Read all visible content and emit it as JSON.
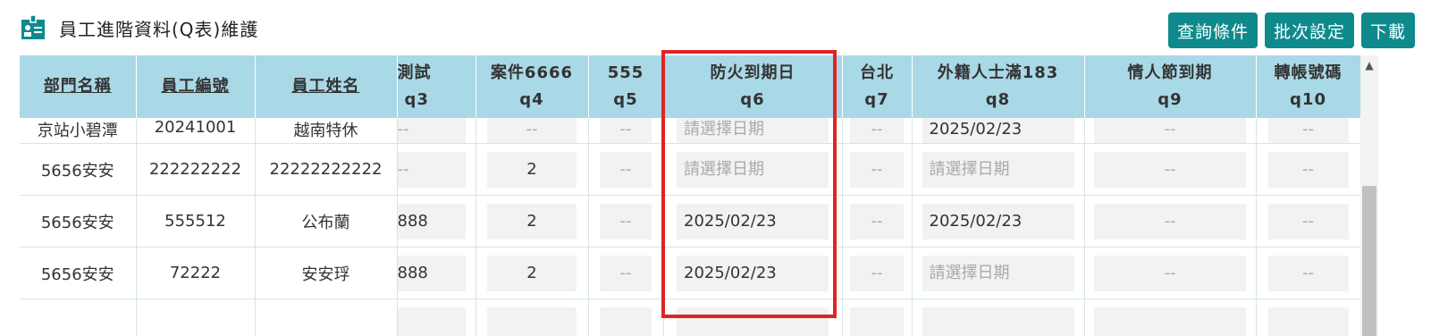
{
  "page": {
    "title": "員工進階資料(Q表)維護"
  },
  "toolbar": {
    "query_label": "查詢條件",
    "batch_label": "批次設定",
    "download_label": "下載"
  },
  "colors": {
    "accent": "#0f8a8c",
    "header_bg": "#a9d8e6",
    "highlight": "#e02424"
  },
  "icons": {
    "title": "id-card-icon",
    "scroll_up": "caret-up-icon"
  },
  "table": {
    "headers": [
      {
        "line1": "部門名稱",
        "line2": ""
      },
      {
        "line1": "員工編號",
        "line2": ""
      },
      {
        "line1": "員工姓名",
        "line2": ""
      },
      {
        "line1": "測試",
        "line2": "q3"
      },
      {
        "line1": "案件6666",
        "line2": "q4"
      },
      {
        "line1": "555",
        "line2": "q5"
      },
      {
        "line1": "防火到期日",
        "line2": "q6"
      },
      {
        "line1": "台北",
        "line2": "q7"
      },
      {
        "line1": "外籍人士滿183",
        "line2": "q8"
      },
      {
        "line1": "情人節到期",
        "line2": "q9"
      },
      {
        "line1": "轉帳號碼",
        "line2": "q10"
      }
    ],
    "rows": [
      {
        "dept": "京站小碧潭",
        "emp_no": "20241001",
        "name": "越南特休",
        "q3": "--",
        "q4": "--",
        "q5": "--",
        "q6": "請選擇日期",
        "q7": "--",
        "q8": "2025/02/23",
        "q9": "--",
        "q10": "--"
      },
      {
        "dept": "5656安安",
        "emp_no": "222222222",
        "name": "22222222222",
        "q3": "--",
        "q4": "2",
        "q5": "--",
        "q6": "請選擇日期",
        "q7": "--",
        "q8": "請選擇日期",
        "q9": "--",
        "q10": "--"
      },
      {
        "dept": "5656安安",
        "emp_no": "555512",
        "name": "公布蘭",
        "q3": "888",
        "q4": "2",
        "q5": "--",
        "q6": "2025/02/23",
        "q7": "--",
        "q8": "2025/02/23",
        "q9": "--",
        "q10": "--"
      },
      {
        "dept": "5656安安",
        "emp_no": "72222",
        "name": "安安琈",
        "q3": "888",
        "q4": "2",
        "q5": "--",
        "q6": "2025/02/23",
        "q7": "--",
        "q8": "請選擇日期",
        "q9": "--",
        "q10": "--"
      },
      {
        "dept": "",
        "emp_no": "",
        "name": "",
        "q3": "",
        "q4": "",
        "q5": "",
        "q6": "",
        "q7": "",
        "q8": "",
        "q9": "",
        "q10": ""
      }
    ]
  }
}
